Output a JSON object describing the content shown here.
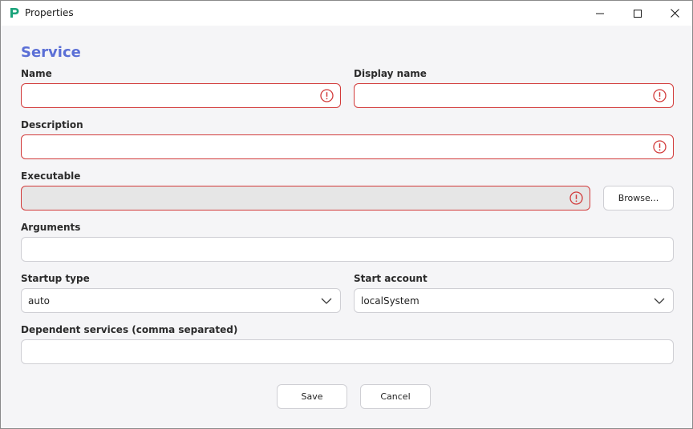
{
  "window": {
    "title": "Properties",
    "icons": {
      "app": "app-logo-icon",
      "minimize": "minimize-icon",
      "maximize": "maximize-icon",
      "close": "close-icon"
    }
  },
  "form": {
    "section_title": "Service",
    "name": {
      "label": "Name",
      "value": "",
      "error": true
    },
    "display_name": {
      "label": "Display name",
      "value": "",
      "error": true
    },
    "description": {
      "label": "Description",
      "value": "",
      "error": true
    },
    "executable": {
      "label": "Executable",
      "value": "",
      "error": true,
      "disabled": true
    },
    "browse_label": "Browse...",
    "arguments": {
      "label": "Arguments",
      "value": ""
    },
    "startup_type": {
      "label": "Startup type",
      "value": "auto"
    },
    "start_account": {
      "label": "Start account",
      "value": "localSystem"
    },
    "dependent_services": {
      "label": "Dependent services (comma separated)",
      "value": ""
    }
  },
  "actions": {
    "save_label": "Save",
    "cancel_label": "Cancel"
  },
  "colors": {
    "accent": "#5b6fd6",
    "error": "#d23a3a",
    "app_icon": "#1aa37a"
  }
}
